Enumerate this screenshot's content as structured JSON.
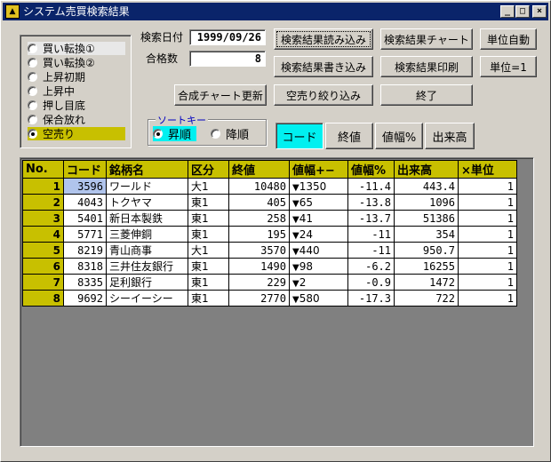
{
  "window": {
    "title": "システム売買検索結果",
    "app_icon": "chart-app-icon",
    "controls": [
      "_",
      "□",
      "×"
    ]
  },
  "signal_group": {
    "options": [
      "買い転換①",
      "買い転換②",
      "上昇初期",
      "上昇中",
      "押し目底",
      "保合放れ",
      "空売り"
    ],
    "selected_index": 6,
    "hover_index": 0
  },
  "search": {
    "date_label": "検索日付",
    "date_value": "1999/09/26",
    "count_label": "合格数",
    "count_value": "8"
  },
  "buttons": {
    "load_results": "検索結果読み込み",
    "save_results": "検索結果書き込み",
    "results_chart": "検索結果チャート",
    "print_results": "検索結果印刷",
    "unit_auto": "単位自動",
    "unit_one": "単位=1",
    "update_chart": "合成チャート更新",
    "short_filter": "空売り絞り込み",
    "exit": "終了"
  },
  "sort_key": {
    "legend": "ソートキー",
    "ascending": "昇順",
    "descending": "降順",
    "selected": "ascending"
  },
  "sort_columns": [
    "コード",
    "終値",
    "値幅%",
    "出来高"
  ],
  "active_sort_column": 0,
  "table": {
    "headers": [
      "No.",
      "コード",
      "銘柄名",
      "区分",
      "終値",
      "値幅+−",
      "値幅%",
      "出来高",
      "×単位"
    ],
    "rows": [
      {
        "no": "1",
        "code": "3596",
        "name": "ワールド",
        "market": "大1",
        "close": "10480",
        "change": "1350",
        "pct": "-11.4",
        "volume": "443.4",
        "unit": "1"
      },
      {
        "no": "2",
        "code": "4043",
        "name": "トクヤマ",
        "market": "東1",
        "close": "405",
        "change": "65",
        "pct": "-13.8",
        "volume": "1096",
        "unit": "1"
      },
      {
        "no": "3",
        "code": "5401",
        "name": "新日本製鉄",
        "market": "東1",
        "close": "258",
        "change": "41",
        "pct": "-13.7",
        "volume": "51386",
        "unit": "1"
      },
      {
        "no": "4",
        "code": "5771",
        "name": "三菱伸銅",
        "market": "東1",
        "close": "195",
        "change": "24",
        "pct": "-11",
        "volume": "354",
        "unit": "1"
      },
      {
        "no": "5",
        "code": "8219",
        "name": "青山商事",
        "market": "大1",
        "close": "3570",
        "change": "440",
        "pct": "-11",
        "volume": "950.7",
        "unit": "1"
      },
      {
        "no": "6",
        "code": "8318",
        "name": "三井住友銀行",
        "market": "東1",
        "close": "1490",
        "change": "98",
        "pct": "-6.2",
        "volume": "16255",
        "unit": "1"
      },
      {
        "no": "7",
        "code": "8335",
        "name": "足利銀行",
        "market": "東1",
        "close": "229",
        "change": "2",
        "pct": "-0.9",
        "volume": "1472",
        "unit": "1"
      },
      {
        "no": "8",
        "code": "9692",
        "name": "シーイーシー",
        "market": "東1",
        "close": "2770",
        "change": "580",
        "pct": "-17.3",
        "volume": "722",
        "unit": "1"
      }
    ],
    "down_marker": "▼",
    "selected_row": 0
  },
  "colors": {
    "accent_yellow": "#c8c000",
    "active_cyan": "#00f0f0",
    "title_bar": "#0a246a",
    "face": "#d4d0c8",
    "selection": "#b0c4ec"
  }
}
